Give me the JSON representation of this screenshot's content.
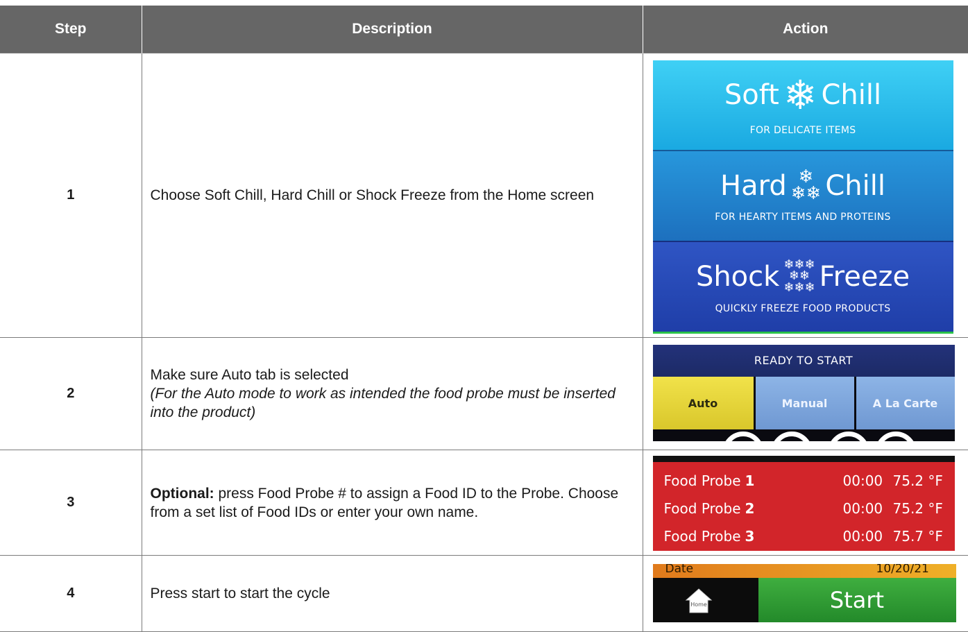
{
  "headers": {
    "step": "Step",
    "description": "Description",
    "action": "Action"
  },
  "rows": [
    {
      "step": "1",
      "description": "Choose Soft Chill, Hard Chill or Shock Freeze from the Home screen"
    },
    {
      "step": "2",
      "description": "Make sure Auto tab is selected",
      "note": "(For the Auto mode to work as intended the food probe must be inserted into the product)"
    },
    {
      "step": "3",
      "description_bold": "Optional:",
      "description": " press Food Probe # to assign a Food ID to the Probe. Choose from a set list of Food IDs or enter your own name."
    },
    {
      "step": "4",
      "description": "Press start to start the cycle"
    }
  ],
  "modes": [
    {
      "word1": "Soft",
      "word2": "Chill",
      "subtitle": "FOR DELICATE ITEMS",
      "icon": "snowflake-icon"
    },
    {
      "word1": "Hard",
      "word2": "Chill",
      "subtitle": "FOR HEARTY ITEMS AND PROTEINS",
      "icon": "snowflake-icon"
    },
    {
      "word1": "Shock",
      "word2": "Freeze",
      "subtitle": "QUICKLY FREEZE FOOD PRODUCTS",
      "icon": "snowflake-icon"
    }
  ],
  "tabs_screen": {
    "status": "READY TO START",
    "tabs": [
      "Auto",
      "Manual",
      "A La Carte"
    ],
    "selected_tab": "Auto"
  },
  "probes": [
    {
      "label": "Food Probe",
      "number": "1",
      "time": "00:00",
      "temp": "75.2 °F"
    },
    {
      "label": "Food Probe",
      "number": "2",
      "time": "00:00",
      "temp": "75.2 °F"
    },
    {
      "label": "Food Probe",
      "number": "3",
      "time": "00:00",
      "temp": "75.7 °F"
    }
  ],
  "start_screen": {
    "date_label": "Date",
    "date_value": "10/20/21",
    "home_label": "Home",
    "start_label": "Start"
  },
  "colors": {
    "header_bg": "#666666",
    "tab_selected": "#e5d43a",
    "probe_bg": "#d2252a",
    "start_bg": "#2f9e36"
  }
}
